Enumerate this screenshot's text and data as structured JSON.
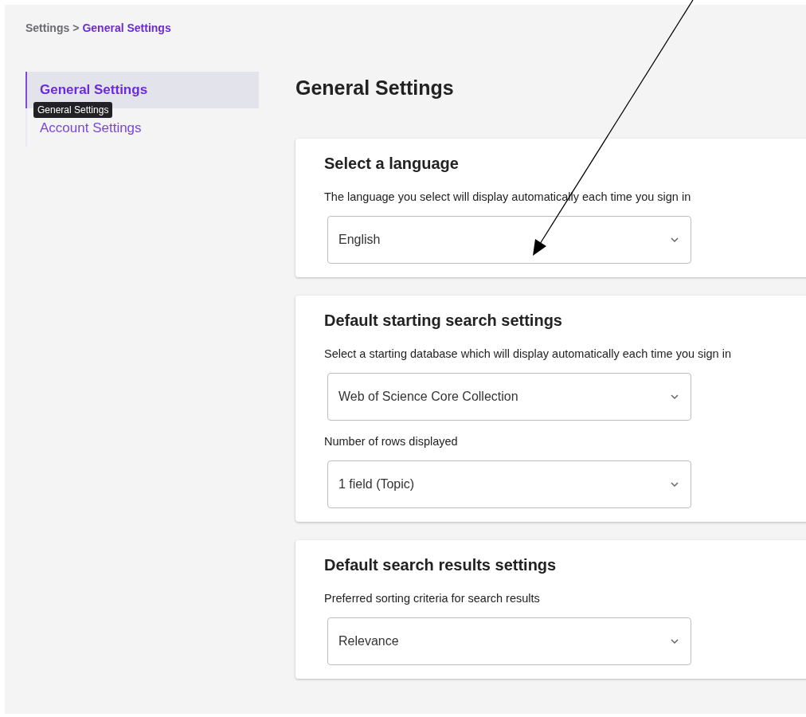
{
  "breadcrumb": [
    {
      "label": "Settings",
      "current": false
    },
    {
      "label": "General Settings",
      "current": true
    }
  ],
  "breadcrumb_separator": ">",
  "sidebar": {
    "items": [
      {
        "label": "General Settings",
        "selected": true
      },
      {
        "label": "Account Settings",
        "selected": false
      }
    ]
  },
  "tooltip": "General Settings",
  "page_title": "General Settings",
  "sections": [
    {
      "title": "Select a language",
      "fields": [
        {
          "label": "The language you select will display automatically each time you sign in",
          "value": "English"
        }
      ]
    },
    {
      "title": "Default starting search settings",
      "fields": [
        {
          "label": "Select a starting database which will display automatically each time you sign in",
          "value": "Web of Science Core Collection"
        },
        {
          "label": "Number of rows displayed",
          "value": "1 field (Topic)"
        }
      ]
    },
    {
      "title": "Default search results settings",
      "fields": [
        {
          "label": "Preferred sorting criteria for search results",
          "value": "Relevance"
        }
      ]
    }
  ]
}
